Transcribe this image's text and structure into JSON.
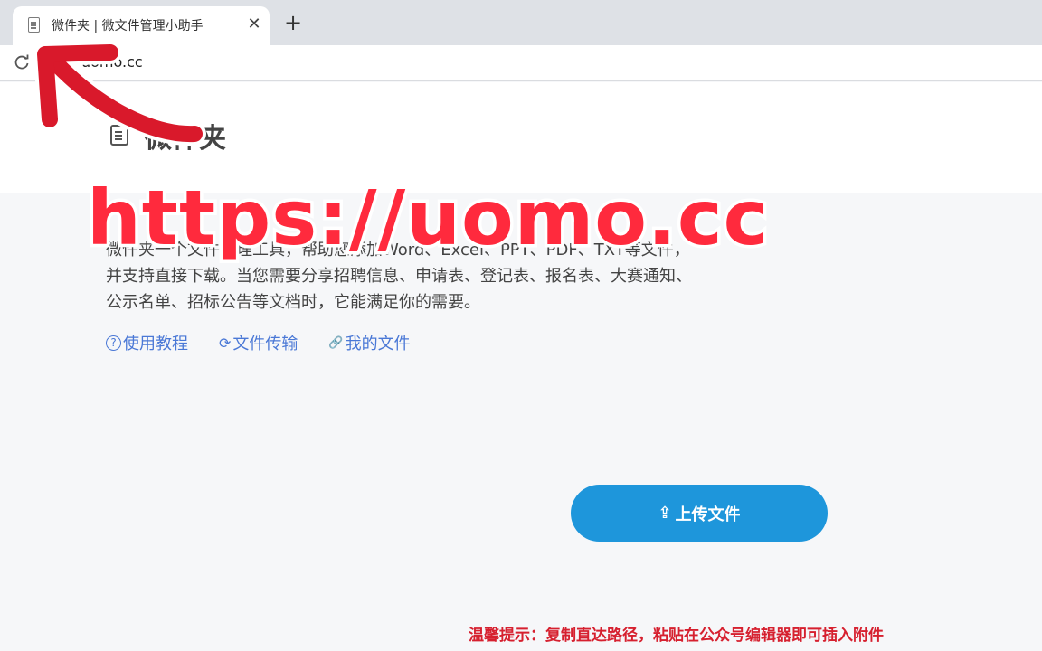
{
  "browser": {
    "tab_title": "微件夹 | 微文件管理小助手",
    "tab_close": "✕",
    "new_tab": "+",
    "url": "uomo.cc"
  },
  "site": {
    "title": "微件夹",
    "intro": "微件夹一个文件管理工具，帮助您添加Word、Excel、PPT、PDF、TXT等文件，并支持直接下载。当您需要分享招聘信息、申请表、登记表、报名表、大赛通知、公示名单、招标公告等文档时，它能满足你的需要。",
    "links": [
      {
        "icon": "?",
        "label": "使用教程"
      },
      {
        "icon": "⟳",
        "label": "文件传输"
      },
      {
        "icon": "🔗",
        "label": "我的文件"
      }
    ],
    "upload_icon": "⇪",
    "upload_label": "上传文件",
    "tip": "温馨提示：复制直达路径，粘贴在公众号编辑器即可插入附件"
  },
  "overlay": {
    "url_text": "https://uomo.cc",
    "colors": {
      "text": "#ff2a3d",
      "stroke": "#ffffff",
      "arrow": "#d9192b"
    }
  }
}
